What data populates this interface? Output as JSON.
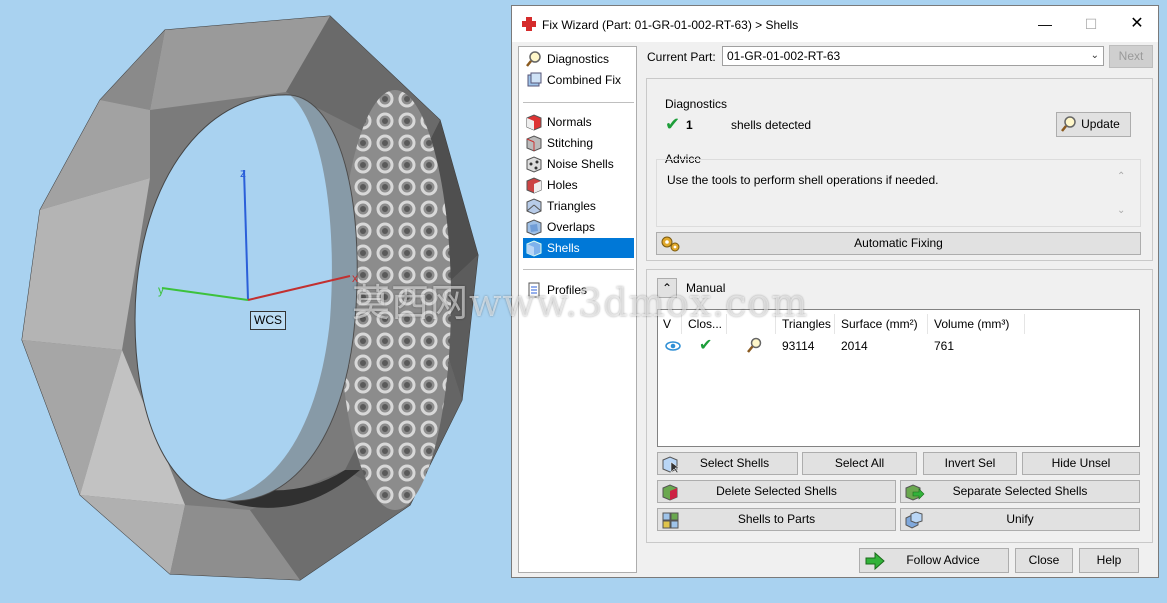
{
  "viewport": {
    "axes": {
      "x": "x",
      "y": "y",
      "z": "z"
    },
    "wcs_label": "WCS",
    "watermark": "莫西网www.3dmox.com"
  },
  "dialog": {
    "title": "Fix Wizard (Part: 01-GR-01-002-RT-63) > Shells",
    "nav": {
      "items": [
        {
          "label": "Diagnostics",
          "icon": "magnifier-icon"
        },
        {
          "label": "Combined Fix",
          "icon": "combined-fix-icon"
        },
        {
          "label": "Normals",
          "icon": "normals-cube-icon"
        },
        {
          "label": "Stitching",
          "icon": "stitching-cube-icon"
        },
        {
          "label": "Noise Shells",
          "icon": "noise-shells-icon"
        },
        {
          "label": "Holes",
          "icon": "holes-cube-icon"
        },
        {
          "label": "Triangles",
          "icon": "triangles-cube-icon"
        },
        {
          "label": "Overlaps",
          "icon": "overlaps-cube-icon"
        },
        {
          "label": "Shells",
          "icon": "shells-cube-icon",
          "active": true
        },
        {
          "label": "Profiles",
          "icon": "profiles-doc-icon"
        }
      ]
    },
    "current_part": {
      "label": "Current Part:",
      "value": "01-GR-01-002-RT-63"
    },
    "next_label": "Next",
    "diagnostics": {
      "title": "Diagnostics",
      "count": "1",
      "text": "shells detected",
      "update_label": "Update"
    },
    "advice": {
      "title": "Advice",
      "text": "Use the tools to perform shell operations if needed."
    },
    "automatic_fixing_label": "Automatic Fixing",
    "manual": {
      "title": "Manual",
      "columns": [
        "V",
        "Clos...",
        "",
        "Triangles",
        "Surface (mm²)",
        "Volume (mm³)"
      ],
      "rows": [
        {
          "triangles": "93114",
          "surface": "2014",
          "volume": "761"
        }
      ]
    },
    "buttons": {
      "select_shells": "Select Shells",
      "select_all": "Select All",
      "invert_sel": "Invert Sel",
      "hide_unsel": "Hide Unsel",
      "delete_selected": "Delete Selected Shells",
      "separate_selected": "Separate Selected Shells",
      "shells_to_parts": "Shells to Parts",
      "unify": "Unify",
      "follow_advice": "Follow Advice",
      "close": "Close",
      "help": "Help"
    },
    "colors": {
      "accent": "#0078d7",
      "check": "#1e9e3a",
      "follow_arrow": "#32b33a"
    }
  }
}
